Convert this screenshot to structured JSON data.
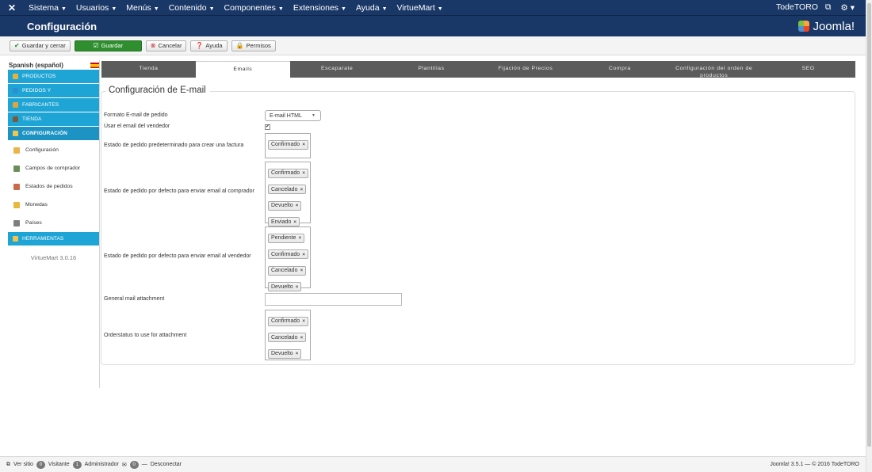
{
  "topmenu": {
    "items": [
      "Sistema",
      "Usuarios",
      "Menús",
      "Contenido",
      "Componentes",
      "Extensiones",
      "Ayuda",
      "VirtueMart"
    ],
    "user": "TodeTORO",
    "settings_icon": "gear-icon"
  },
  "header": {
    "title": "Configuración",
    "logo_text": "Joomla!"
  },
  "toolbar": {
    "save_close": "Guardar y cerrar",
    "save": "Guardar",
    "cancel": "Cancelar",
    "help": "Ayuda",
    "permissions": "Permisos"
  },
  "sidebar": {
    "language": "Spanish (español)",
    "sections": [
      "PRODUCTOS",
      "PEDIDOS Y",
      "FABRICANTES",
      "TIENDA",
      "CONFIGURACIÓN"
    ],
    "config_items": [
      "Configuración",
      "Campos de comprador",
      "Estados de pedidos",
      "Monedas",
      "Países"
    ],
    "tools": "HERRAMIENTAS",
    "version": "VirtueMart 3.0.16"
  },
  "tabs": [
    "Tienda",
    "Emails",
    "Escaparate",
    "Plantillas",
    "Fijación de Precios",
    "Compra",
    "Configuración del orden de productos",
    "SEO"
  ],
  "form": {
    "legend": "Configuración de E-mail",
    "email_format_label": "Formato E-mail de pedido",
    "email_format_value": "E-mail HTML",
    "use_vendor_email_label": "Usar el email del vendedor",
    "invoice_status_label": "Estado de pedido predeterminado para crear una factura",
    "invoice_status_chips": [
      "Confirmado"
    ],
    "buyer_email_label": "Estado de pedido por defecto para enviar email al comprador",
    "buyer_email_chips": [
      "Confirmado",
      "Cancelado",
      "Devuelto",
      "Enviado"
    ],
    "vendor_email_label": "Estado de pedido por defecto para enviar email al vendedor",
    "vendor_email_chips": [
      "Pendiente",
      "Confirmado",
      "Cancelado",
      "Devuelto"
    ],
    "attachment_label": "General mail attachment",
    "attachment_value": "",
    "attach_status_label": "Orderstatus to use for attachment",
    "attach_status_chips": [
      "Confirmado",
      "Cancelado",
      "Devuelto"
    ]
  },
  "footer": {
    "view_site": "Ver sitio",
    "visitors_count": "0",
    "visitors_label": "Visitante",
    "admins_count": "1",
    "admins_label": "Administrador",
    "messages_count": "0",
    "logout": "Desconectar",
    "copyright": "Joomla! 3.5.1 — © 2016 TodeTORO"
  }
}
